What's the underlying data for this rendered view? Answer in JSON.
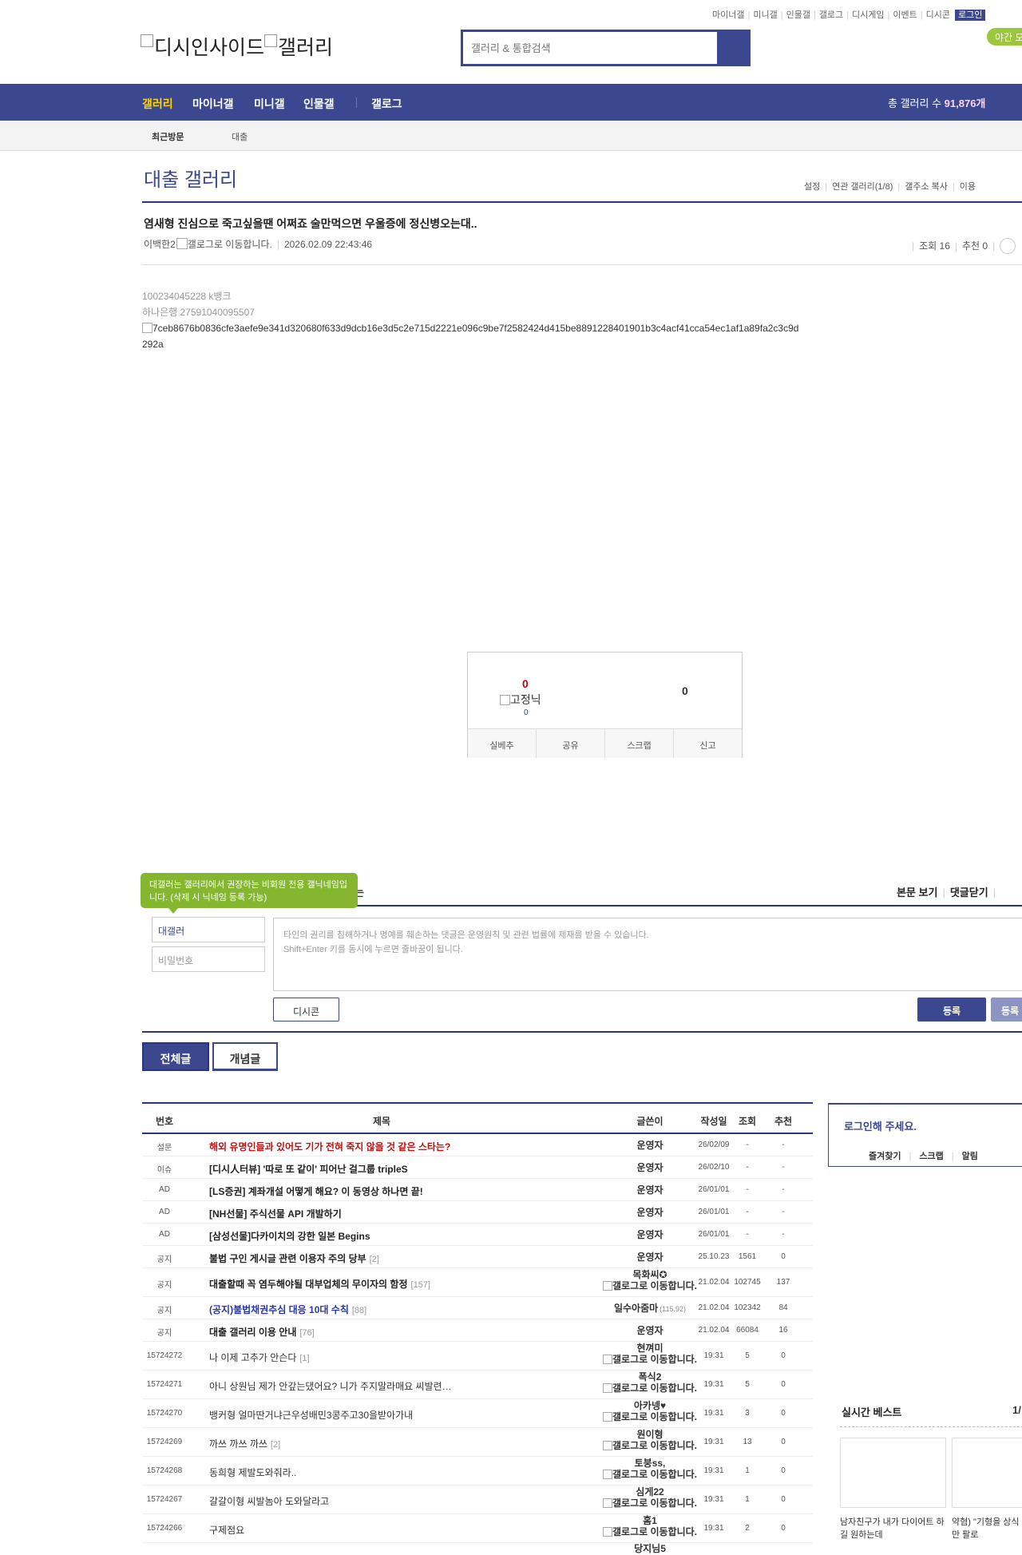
{
  "util": {
    "links": [
      "마이너갤",
      "미니갤",
      "인물갤",
      "갤로그",
      "디시게임",
      "이벤트",
      "디시콘"
    ],
    "login": "로그인",
    "night": "야간 모"
  },
  "logo": {
    "text": "디시인사이드",
    "sub": "갤러리"
  },
  "search": {
    "placeholder": "갤러리 & 통합검색"
  },
  "nav": {
    "items": [
      "갤러리",
      "마이너갤",
      "미니갤",
      "인물갤",
      "갤로그"
    ],
    "total_label": "총 갤러리 수",
    "total_value": "91,876개",
    "active_color": "#ffd400",
    "bar_color": "#3b4890"
  },
  "subnav": {
    "recent": "최근방문",
    "item": "대출"
  },
  "gallery": {
    "title": "대출 갤러리",
    "links": [
      "설정",
      "연관 갤러리(1/8)",
      "갤주소 복사",
      "이용"
    ]
  },
  "post": {
    "title": "염새형 진심으로 죽고싶을땐 어쩌죠 술만먹으면 우울증에 정신병오는대..",
    "author": "이백한2",
    "author_img_alt": "갤로그로 이동합니다.",
    "datetime": "2026.02.09 22:43:46",
    "views_label": "조회 16",
    "recommend_label": "추천 0",
    "body": [
      "100234045228 k뱅크",
      "하나은행 27591040095507"
    ],
    "image_alt": "7ceb8676b0836cfe3aefe9e341d320680f633d9dcb16e3d5c2e715d2221e096c9be7f2582424d415be8891228401901b3c4acf41cca54ec1af1a89fa2c3c9d",
    "image_alt_2": "292a"
  },
  "recommend": {
    "up": "0",
    "fixed_label": "고정닉",
    "fixed_count": "0",
    "down": "0",
    "buttons": [
      "실베추",
      "공유",
      "스크랩",
      "신고"
    ]
  },
  "comment": {
    "tooltip": "대갤러는 갤러리에서 권장하는 비회원 전용 갤닉네임입니다. (삭제 시 닉네임 등록 가능)",
    "tooltip_tail": "는",
    "view_body": "본문 보기",
    "close_comments": "댓글닫기",
    "name_value": "대갤러",
    "password_placeholder": "비밀번호",
    "area_placeholder_1": "타인의 권리를 침해하거나 명예를 훼손하는 댓글은 운영원칙 및 관련 법률에 제재를 받을 수 있습니다.",
    "area_placeholder_2": "Shift+Enter 키를 동시에 누르면 줄바꿈이 됩니다.",
    "dccon": "디시콘",
    "submit": "등록",
    "submit2": "등록"
  },
  "tabs": {
    "all": "전체글",
    "concept": "개념글"
  },
  "board": {
    "headers": [
      "번호",
      "제목",
      "글쓴이",
      "작성일",
      "조회",
      "추천"
    ],
    "rows": [
      {
        "no": "설문",
        "subject": "해외 유명인들과 있어도 기가 전혀 죽지 않을 것 같은 스타는?",
        "count": "",
        "writer": "운영자",
        "writer2": "",
        "date": "26/02/09",
        "views": "-",
        "rec": "-",
        "style": "red",
        "h": 28
      },
      {
        "no": "이슈",
        "subject": "[디시人터뷰] '따로 또 같이' 피어난 걸그룹 tripleS",
        "count": "",
        "writer": "운영자",
        "writer2": "",
        "date": "26/02/10",
        "views": "-",
        "rec": "-",
        "style": "bold",
        "h": 28
      },
      {
        "no": "AD",
        "subject": "[LS증권] 계좌개설 어떻게 해요? 이 동영상 하나면 끝!",
        "count": "",
        "writer": "운영자",
        "writer2": "",
        "date": "26/01/01",
        "views": "-",
        "rec": "-",
        "style": "bold",
        "h": 28
      },
      {
        "no": "AD",
        "subject": "[NH선물] 주식선물 API 개발하기",
        "count": "",
        "writer": "운영자",
        "writer2": "",
        "date": "26/01/01",
        "views": "-",
        "rec": "-",
        "style": "bold",
        "h": 28
      },
      {
        "no": "AD",
        "subject": "[삼성선물]다카이치의 강한 일본 Begins",
        "count": "",
        "writer": "운영자",
        "writer2": "",
        "date": "26/01/01",
        "views": "-",
        "rec": "-",
        "style": "bold",
        "h": 28
      },
      {
        "no": "공지",
        "subject": "불법 구인 게시글 관련 이용자 주의 당부",
        "count": "[2]",
        "writer": "운영자",
        "writer2": "",
        "date": "25.10.23",
        "views": "1561",
        "rec": "0",
        "style": "bold",
        "h": 28
      },
      {
        "no": "공지",
        "subject": "대출할때 꼭 염두해야될 대부업체의 무이자의 함정",
        "count": "[157]",
        "writer": "목화씨✪",
        "writer2": "갤로그로 이동합니다.",
        "date": "21.02.04",
        "views": "102745",
        "rec": "137",
        "style": "bold",
        "h": 36
      },
      {
        "no": "공지",
        "subject": "(공지)불법채권추심 대응 10대 수칙",
        "count": "[88]",
        "writer": "일수아줌마",
        "writer2": "(115.92)",
        "date": "21.02.04",
        "views": "102342",
        "rec": "84",
        "style": "blue",
        "h": 28
      },
      {
        "no": "공지",
        "subject": "대출 갤러리 이용 안내",
        "count": "[76]",
        "writer": "운영자",
        "writer2": "",
        "date": "21.02.04",
        "views": "66084",
        "rec": "16",
        "style": "bold",
        "h": 28
      },
      {
        "no": "15724272",
        "subject": "나 이제 고추가 안슨다",
        "count": "[1]",
        "writer": "현껴미",
        "writer2": "갤로그로 이동합니다.",
        "date": "19:31",
        "views": "5",
        "rec": "0",
        "style": "norm",
        "h": 36
      },
      {
        "no": "15724271",
        "subject": "아니 상원님 제가 안갚는댔어요? 니가 주지말라매요 씨발련…",
        "count": "",
        "writer": "폭식2",
        "writer2": "갤로그로 이동합니다.",
        "date": "19:31",
        "views": "5",
        "rec": "0",
        "style": "norm",
        "h": 36
      },
      {
        "no": "15724270",
        "subject": "뱅커형 얼마딴거냐근우성배민3콩주고30을받아가내",
        "count": "",
        "writer": "아카넹♥",
        "writer2": "갤로그로 이동합니다.",
        "date": "19:31",
        "views": "3",
        "rec": "0",
        "style": "norm",
        "h": 36
      },
      {
        "no": "15724269",
        "subject": "까쓰 까쓰 까쓰",
        "count": "[2]",
        "writer": "원이형",
        "writer2": "갤로그로 이동합니다.",
        "date": "19:31",
        "views": "13",
        "rec": "0",
        "style": "norm",
        "h": 36
      },
      {
        "no": "15724268",
        "subject": "동희형 제발도와줘라..",
        "count": "",
        "writer": "토붕ss,",
        "writer2": "갤로그로 이동합니다.",
        "date": "19:31",
        "views": "1",
        "rec": "0",
        "style": "norm",
        "h": 36
      },
      {
        "no": "15724267",
        "subject": "갈갈이형 씨발놈아 도와달라고",
        "count": "",
        "writer": "심게22",
        "writer2": "갤로그로 이동합니다.",
        "date": "19:31",
        "views": "1",
        "rec": "0",
        "style": "norm",
        "h": 36
      },
      {
        "no": "15724266",
        "subject": "구제점요",
        "count": "",
        "writer": "홈1",
        "writer2": "갤로그로 이동합니다.",
        "date": "19:31",
        "views": "2",
        "rec": "0",
        "style": "norm",
        "h": 36
      },
      {
        "no": "",
        "subject": "",
        "count": "",
        "writer": "당지님5",
        "writer2": "",
        "date": "",
        "views": "",
        "rec": "",
        "style": "norm",
        "h": 36
      }
    ]
  },
  "login_box": {
    "title": "로그인해 주세요.",
    "links": [
      "즐겨찾기",
      "스크랩",
      "알림"
    ]
  },
  "best": {
    "title": "실시간 베스트",
    "page": "1/",
    "items": [
      "남자친구가 내가 다이어트 하길 원하는데",
      "약혐) \"기형을 상식 다니\" 33만 팔로"
    ]
  }
}
